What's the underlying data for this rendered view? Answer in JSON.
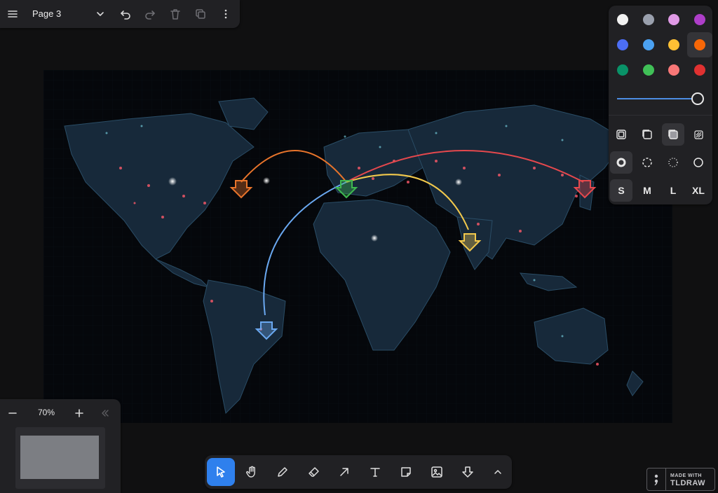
{
  "top_menu": {
    "page_name": "Page 3",
    "icons": [
      "menu-icon",
      "chevron-down-icon",
      "undo-icon",
      "redo-icon",
      "trash-icon",
      "duplicate-icon",
      "more-icon"
    ]
  },
  "canvas": {
    "image": "world-map-night",
    "arrows": [
      {
        "marker": "orange-arrow-marker",
        "color": "#e8742b"
      },
      {
        "marker": "green-arrow-marker",
        "color": "#3fb950"
      },
      {
        "marker": "red-arrow-marker",
        "color": "#e5484d"
      },
      {
        "marker": "yellow-arrow-marker",
        "color": "#f2c94c"
      },
      {
        "marker": "blue-arrow-marker",
        "color": "#6aa8f0"
      }
    ]
  },
  "style_panel": {
    "colors": [
      {
        "name": "white",
        "hex": "#f2f2f2"
      },
      {
        "name": "grey",
        "hex": "#9aa0ad"
      },
      {
        "name": "light-violet",
        "hex": "#e09ae6"
      },
      {
        "name": "violet",
        "hex": "#ae3ec9"
      },
      {
        "name": "blue",
        "hex": "#4c6ef5"
      },
      {
        "name": "light-blue",
        "hex": "#4ba1f1"
      },
      {
        "name": "yellow",
        "hex": "#ffc034"
      },
      {
        "name": "orange",
        "hex": "#f76707"
      },
      {
        "name": "green",
        "hex": "#099268"
      },
      {
        "name": "light-green",
        "hex": "#40c057"
      },
      {
        "name": "light-red",
        "hex": "#f87777"
      },
      {
        "name": "red",
        "hex": "#e03131"
      }
    ],
    "selected_color": "orange",
    "opacity": 1.0,
    "fill_icons": [
      "fill-none-icon",
      "fill-semi-icon",
      "fill-solid-icon",
      "fill-pattern-icon"
    ],
    "selected_fill": "fill-solid-icon",
    "dash_icons": [
      "dash-draw-icon",
      "dash-dashed-icon",
      "dash-dotted-icon",
      "dash-solid-icon"
    ],
    "selected_dash": "dash-draw-icon",
    "sizes": [
      "S",
      "M",
      "L",
      "XL"
    ],
    "selected_size": "S"
  },
  "navigation": {
    "zoom_out_icon": "minus-icon",
    "zoom_level": "70%",
    "zoom_in_icon": "plus-icon",
    "collapse_icon": "double-chevron-left-icon"
  },
  "toolbar": {
    "tools": [
      "select",
      "hand",
      "draw",
      "eraser",
      "arrow",
      "text",
      "note",
      "image",
      "shape",
      "more"
    ],
    "selected_tool": "select"
  },
  "watermark": {
    "made_with": "MADE WITH",
    "brand": "TLDRAW"
  }
}
